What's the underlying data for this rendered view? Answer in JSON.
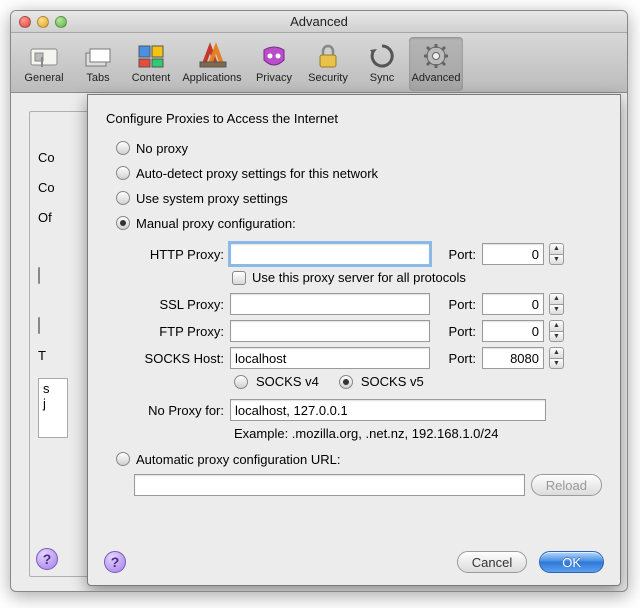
{
  "window": {
    "title": "Advanced"
  },
  "toolbar": {
    "items": [
      {
        "label": "General"
      },
      {
        "label": "Tabs"
      },
      {
        "label": "Content"
      },
      {
        "label": "Applications"
      },
      {
        "label": "Privacy"
      },
      {
        "label": "Security"
      },
      {
        "label": "Sync"
      },
      {
        "label": "Advanced"
      }
    ]
  },
  "bg": {
    "line1": "Co",
    "line2": "Co",
    "line3": "Of",
    "line4": "T",
    "line5a": "s",
    "line5b": "j"
  },
  "sheet": {
    "heading": "Configure Proxies to Access the Internet",
    "opt_no_proxy": "No proxy",
    "opt_auto_detect": "Auto-detect proxy settings for this network",
    "opt_system": "Use system proxy settings",
    "opt_manual": "Manual proxy configuration:",
    "http_label": "HTTP Proxy:",
    "port_label": "Port:",
    "http_port": "0",
    "use_all_label": "Use this proxy server for all protocols",
    "ssl_label": "SSL Proxy:",
    "ssl_port": "0",
    "ftp_label": "FTP Proxy:",
    "ftp_port": "0",
    "socks_label": "SOCKS Host:",
    "socks_host": "localhost",
    "socks_port": "8080",
    "socks_v4": "SOCKS v4",
    "socks_v5": "SOCKS v5",
    "noproxy_label": "No Proxy for:",
    "noproxy_value": "localhost, 127.0.0.1",
    "example": "Example: .mozilla.org, .net.nz, 192.168.1.0/24",
    "opt_pac": "Automatic proxy configuration URL:",
    "reload": "Reload",
    "cancel": "Cancel",
    "ok": "OK"
  }
}
